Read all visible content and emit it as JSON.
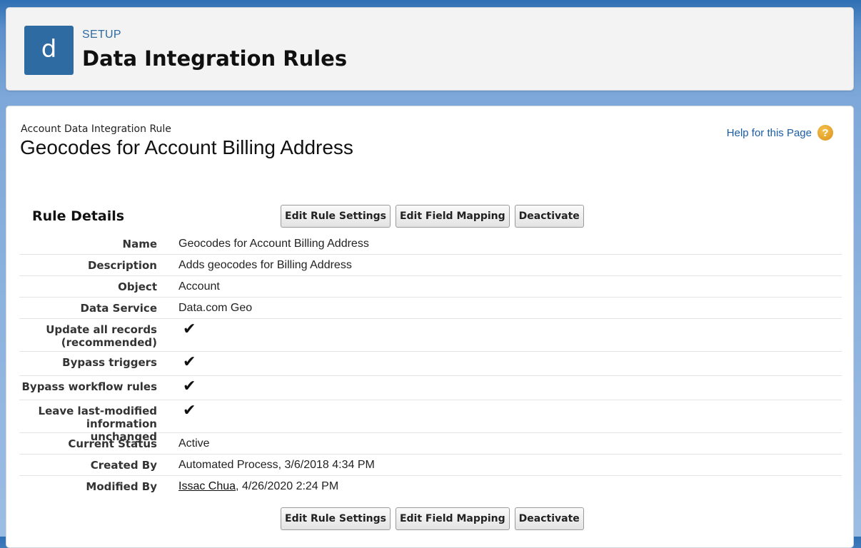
{
  "header": {
    "icon_letter": "d",
    "setup_label": "SETUP",
    "title": "Data Integration Rules"
  },
  "record": {
    "type_label": "Account Data Integration Rule",
    "title": "Geocodes for Account Billing Address",
    "help_link": "Help for this Page",
    "help_icon_glyph": "?"
  },
  "section": {
    "title": "Rule Details"
  },
  "buttons": {
    "edit_rule_settings": "Edit Rule Settings",
    "edit_field_mapping": "Edit Field Mapping",
    "deactivate": "Deactivate"
  },
  "details": {
    "name": {
      "label": "Name",
      "value": "Geocodes for Account Billing Address"
    },
    "description": {
      "label": "Description",
      "value": "Adds geocodes for Billing Address"
    },
    "object": {
      "label": "Object",
      "value": "Account"
    },
    "data_service": {
      "label": "Data Service",
      "value": "Data.com Geo"
    },
    "update_all": {
      "label": "Update all records (recommended)",
      "checked": true
    },
    "bypass_triggers": {
      "label": "Bypass triggers",
      "checked": true
    },
    "bypass_workflow": {
      "label": "Bypass workflow rules",
      "checked": true
    },
    "leave_modified": {
      "label": "Leave last-modified information unchanged",
      "checked": true
    },
    "current_status": {
      "label": "Current Status",
      "value": "Active"
    },
    "created_by": {
      "label": "Created By",
      "value": "Automated Process, 3/6/2018 4:34 PM"
    },
    "modified_by": {
      "label": "Modified By",
      "user": "Issac Chua",
      "date": ", 4/26/2020 2:24 PM"
    }
  },
  "check_glyph": "✔",
  "colors": {
    "brand_blue": "#2f6ba3",
    "link_blue": "#1b5ea6",
    "help_orange": "#e8a52a"
  }
}
